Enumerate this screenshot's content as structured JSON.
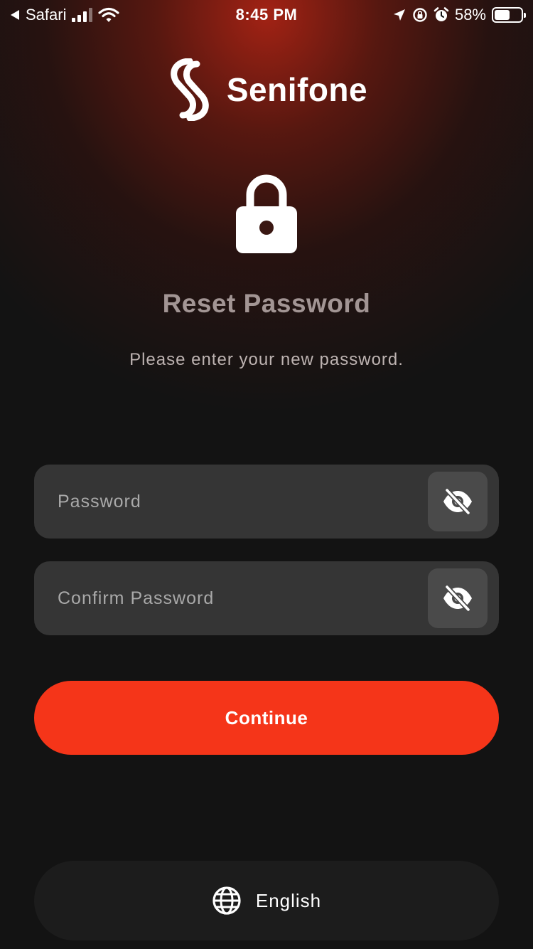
{
  "status_bar": {
    "back_app": "Safari",
    "time": "8:45 PM",
    "battery": "58%",
    "battery_level": 0.58
  },
  "brand": {
    "name": "Senifone"
  },
  "header": {
    "title": "Reset Password",
    "subtitle": "Please enter your new password."
  },
  "form": {
    "password_placeholder": "Password",
    "password_value": "",
    "confirm_placeholder": "Confirm Password",
    "confirm_value": "",
    "continue_label": "Continue"
  },
  "language": {
    "label": "English"
  },
  "colors": {
    "accent": "#f53519",
    "field_bg": "#353535",
    "background": "#131313"
  }
}
